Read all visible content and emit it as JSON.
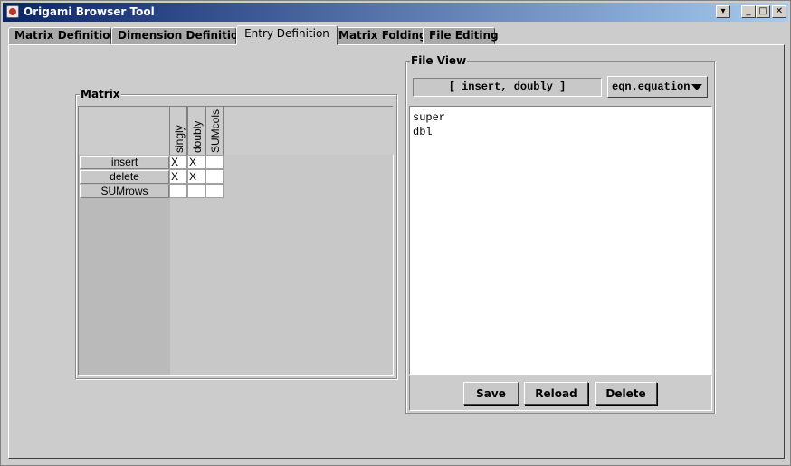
{
  "window": {
    "title": "Origami Browser Tool",
    "controls": {
      "menu": "▾",
      "minimize": "_",
      "maximize": "□",
      "close": "✕"
    }
  },
  "tabs": [
    {
      "label": "Matrix Definition",
      "active": false
    },
    {
      "label": "Dimension Definition",
      "active": false
    },
    {
      "label": "Entry Definition",
      "active": true
    },
    {
      "label": "Matrix Folding",
      "active": false
    },
    {
      "label": "File Editing",
      "active": false
    }
  ],
  "matrix": {
    "title": "Matrix",
    "columns": [
      "singly",
      "doubly",
      "SUMcols"
    ],
    "rows": [
      {
        "label": "insert",
        "cells": [
          "X",
          "X",
          ""
        ]
      },
      {
        "label": "delete",
        "cells": [
          "X",
          "X",
          ""
        ]
      },
      {
        "label": "SUMrows",
        "cells": [
          "",
          "",
          ""
        ]
      }
    ]
  },
  "file_view": {
    "title": "File View",
    "selection_label": "[ insert, doubly ]",
    "file_select": "eqn.equation",
    "content": "super\ndbl",
    "buttons": {
      "save": "Save",
      "reload": "Reload",
      "delete": "Delete"
    }
  }
}
